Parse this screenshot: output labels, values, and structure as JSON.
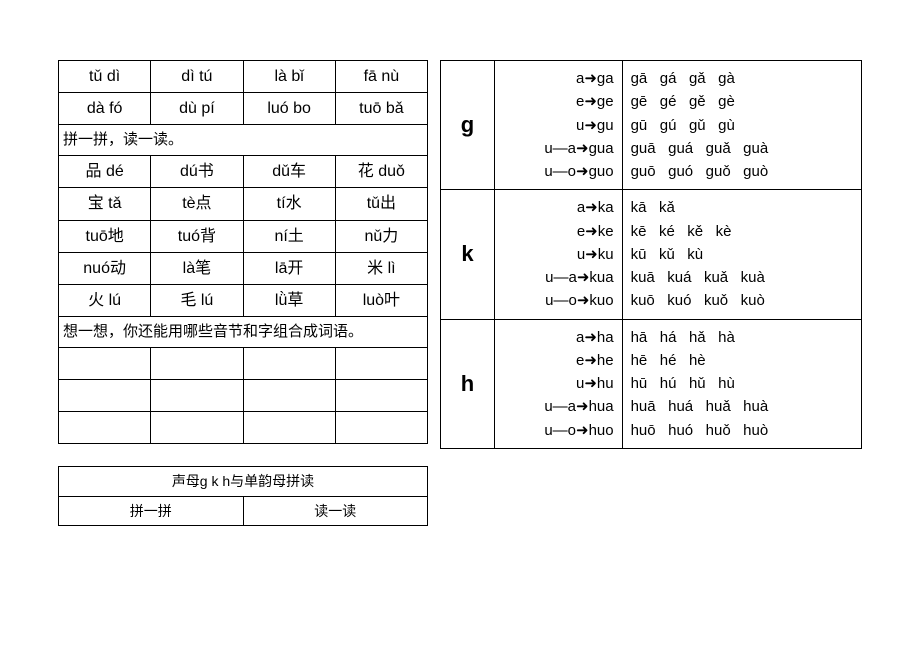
{
  "left": {
    "row1": [
      "tǔ dì",
      "dì tú",
      "là bǐ",
      "fā nù"
    ],
    "row2": [
      "dà fó",
      "dù pí",
      "luó bo",
      "tuō bǎ"
    ],
    "label1": "拼一拼，读一读。",
    "row3": [
      "品 dé",
      "dú书",
      "dǔ车",
      "花 duǒ"
    ],
    "row4": [
      "宝 tǎ",
      "tè点",
      "tí水",
      "tǔ出"
    ],
    "row5": [
      "tuō地",
      "tuó背",
      "ní土",
      "nǔ力"
    ],
    "row6": [
      "nuó动",
      "là笔",
      "lā开",
      "米 lì"
    ],
    "row7": [
      "火 lú",
      "毛 lú",
      "lǜ草",
      "luò叶"
    ],
    "label2": "想一想，你还能用哪些音节和字组合成词语。"
  },
  "mini": {
    "title": "声母g k h与单韵母拼读",
    "c1": "拼一拼",
    "c2": "读一读"
  },
  "right": {
    "g": {
      "letter": "g",
      "rules": [
        "a➜ga",
        "e➜ge",
        "u➜gu",
        "u—a➜gua",
        "u—o➜guo"
      ],
      "tones": [
        "gā   gá   gǎ   gà",
        "gē   gé   gě   gè",
        "gū   gú   gǔ   gù",
        "guā   guá   guǎ   guà",
        "guō   guó   guǒ   guò"
      ]
    },
    "k": {
      "letter": "k",
      "rules": [
        "a➜ka",
        "e➜ke",
        "u➜ku",
        "u—a➜kua",
        "u—o➜kuo"
      ],
      "tones": [
        "kā   kǎ",
        "kē   ké   kě   kè",
        "kū   kǔ   kù",
        "kuā   kuá   kuǎ   kuà",
        "kuō   kuó   kuǒ   kuò"
      ]
    },
    "h": {
      "letter": "h",
      "rules": [
        "a➜ha",
        "e➜he",
        "u➜hu",
        "u—a➜hua",
        "u—o➜huo"
      ],
      "tones": [
        "hā   há   hǎ   hà",
        "hē   hé   hè",
        "hū   hú   hǔ   hù",
        "huā   huá   huǎ   huà",
        "huō   huó   huǒ   huò"
      ]
    }
  }
}
